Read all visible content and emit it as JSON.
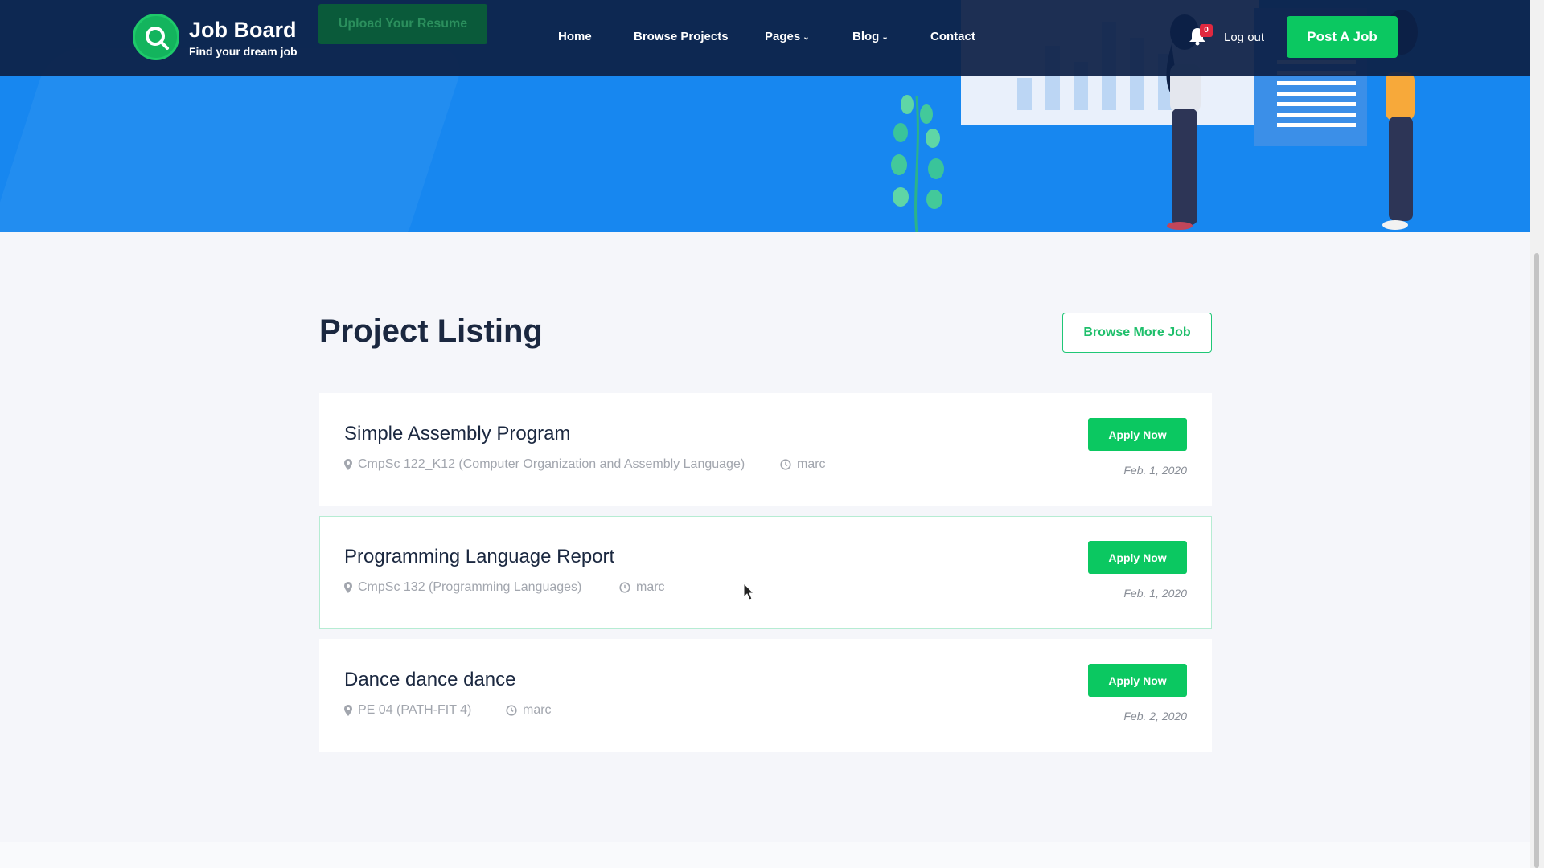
{
  "header": {
    "brand_name": "Job Board",
    "brand_tagline": "Find your dream job",
    "upload_label": "Upload Your Resume",
    "nav": {
      "home": "Home",
      "browse_projects": "Browse Projects",
      "pages": "Pages",
      "blog": "Blog",
      "contact": "Contact"
    },
    "notification_count": "0",
    "logout_label": "Log out",
    "post_job_label": "Post A Job"
  },
  "section": {
    "title": "Project Listing",
    "browse_more_label": "Browse More Job"
  },
  "jobs": [
    {
      "title": "Simple Assembly Program",
      "course": "CmpSc 122_K12 (Computer Organization and Assembly Language)",
      "author": "marc",
      "apply_label": "Apply Now",
      "date": "Feb. 1, 2020"
    },
    {
      "title": "Programming Language Report",
      "course": "CmpSc 132 (Programming Languages)",
      "author": "marc",
      "apply_label": "Apply Now",
      "date": "Feb. 1, 2020"
    },
    {
      "title": "Dance dance dance",
      "course": "PE 04 (PATH-FIT 4)",
      "author": "marc",
      "apply_label": "Apply Now",
      "date": "Feb. 2, 2020"
    }
  ],
  "colors": {
    "accent_green": "#0bc861",
    "header_navy": "#0d2046",
    "hero_blue": "#1787f0"
  }
}
